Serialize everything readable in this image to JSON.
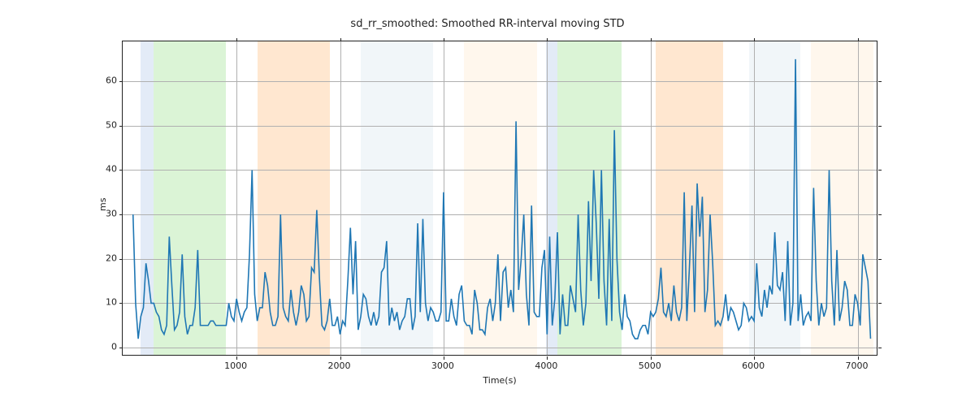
{
  "chart_data": {
    "type": "line",
    "title": "sd_rr_smoothed: Smoothed RR-interval moving STD",
    "xlabel": "Time(s)",
    "ylabel": "ms",
    "xlim": [
      -100,
      7200
    ],
    "ylim": [
      -2,
      69
    ],
    "xticks": [
      1000,
      2000,
      3000,
      4000,
      5000,
      6000,
      7000
    ],
    "yticks": [
      0,
      10,
      20,
      30,
      40,
      50,
      60
    ],
    "line_color": "#1f77b4",
    "bands": [
      {
        "x0": 70,
        "x1": 200,
        "color": "#aec7e8"
      },
      {
        "x0": 200,
        "x1": 900,
        "color": "#98df8a"
      },
      {
        "x0": 1200,
        "x1": 1900,
        "color": "#ffbb78"
      },
      {
        "x0": 2200,
        "x1": 2900,
        "color": "#d6e4ef"
      },
      {
        "x0": 3200,
        "x1": 3900,
        "color": "#ffe7cc"
      },
      {
        "x0": 3990,
        "x1": 4100,
        "color": "#aec7e8"
      },
      {
        "x0": 4100,
        "x1": 4720,
        "color": "#98df8a"
      },
      {
        "x0": 5050,
        "x1": 5700,
        "color": "#ffbb78"
      },
      {
        "x0": 5950,
        "x1": 6450,
        "color": "#d6e4ef"
      },
      {
        "x0": 6550,
        "x1": 7150,
        "color": "#ffe7cc"
      }
    ],
    "x": [
      0,
      25,
      50,
      75,
      100,
      125,
      150,
      175,
      200,
      225,
      250,
      275,
      300,
      325,
      350,
      375,
      400,
      425,
      450,
      475,
      500,
      525,
      550,
      575,
      600,
      625,
      650,
      675,
      700,
      725,
      750,
      775,
      800,
      825,
      850,
      875,
      900,
      925,
      950,
      975,
      1000,
      1025,
      1050,
      1075,
      1100,
      1125,
      1150,
      1175,
      1200,
      1225,
      1250,
      1275,
      1300,
      1325,
      1350,
      1375,
      1400,
      1425,
      1450,
      1475,
      1500,
      1525,
      1550,
      1575,
      1600,
      1625,
      1650,
      1675,
      1700,
      1725,
      1750,
      1775,
      1800,
      1825,
      1850,
      1875,
      1900,
      1925,
      1950,
      1975,
      2000,
      2025,
      2050,
      2075,
      2100,
      2125,
      2150,
      2175,
      2200,
      2225,
      2250,
      2275,
      2300,
      2325,
      2350,
      2375,
      2400,
      2425,
      2450,
      2475,
      2500,
      2525,
      2550,
      2575,
      2600,
      2625,
      2650,
      2675,
      2700,
      2725,
      2750,
      2775,
      2800,
      2825,
      2850,
      2875,
      2900,
      2925,
      2950,
      2975,
      3000,
      3025,
      3050,
      3075,
      3100,
      3125,
      3150,
      3175,
      3200,
      3225,
      3250,
      3275,
      3300,
      3325,
      3350,
      3375,
      3400,
      3425,
      3450,
      3475,
      3500,
      3525,
      3550,
      3575,
      3600,
      3625,
      3650,
      3675,
      3700,
      3725,
      3750,
      3775,
      3800,
      3825,
      3850,
      3875,
      3900,
      3925,
      3950,
      3975,
      4000,
      4025,
      4050,
      4075,
      4100,
      4125,
      4150,
      4175,
      4200,
      4225,
      4250,
      4275,
      4300,
      4325,
      4350,
      4375,
      4400,
      4425,
      4450,
      4475,
      4500,
      4525,
      4550,
      4575,
      4600,
      4625,
      4650,
      4675,
      4700,
      4725,
      4750,
      4775,
      4800,
      4825,
      4850,
      4875,
      4900,
      4925,
      4950,
      4975,
      5000,
      5025,
      5050,
      5075,
      5100,
      5125,
      5150,
      5175,
      5200,
      5225,
      5250,
      5275,
      5300,
      5325,
      5350,
      5375,
      5400,
      5425,
      5450,
      5475,
      5500,
      5525,
      5550,
      5575,
      5600,
      5625,
      5650,
      5675,
      5700,
      5725,
      5750,
      5775,
      5800,
      5825,
      5850,
      5875,
      5900,
      5925,
      5950,
      5975,
      6000,
      6025,
      6050,
      6075,
      6100,
      6125,
      6150,
      6175,
      6200,
      6225,
      6250,
      6275,
      6300,
      6325,
      6350,
      6375,
      6400,
      6425,
      6450,
      6475,
      6500,
      6525,
      6550,
      6575,
      6600,
      6625,
      6650,
      6675,
      6700,
      6725,
      6750,
      6775,
      6800,
      6825,
      6850,
      6875,
      6900,
      6925,
      6950,
      6975,
      7000,
      7025,
      7050,
      7075,
      7100,
      7125,
      7150
    ],
    "y": [
      30,
      10,
      2,
      7,
      9,
      19,
      15,
      10,
      10,
      8,
      7,
      4,
      3,
      5,
      25,
      14,
      4,
      5,
      8,
      21,
      7,
      3,
      5,
      5,
      9,
      22,
      5,
      5,
      5,
      5,
      6,
      6,
      5,
      5,
      5,
      5,
      5,
      10,
      7,
      6,
      11,
      8,
      6,
      8,
      9,
      21,
      40,
      12,
      6,
      9,
      9,
      17,
      14,
      8,
      5,
      5,
      7,
      30,
      9,
      7,
      6,
      13,
      8,
      5,
      8,
      14,
      12,
      6,
      7,
      18,
      17,
      31,
      16,
      5,
      4,
      6,
      11,
      5,
      5,
      7,
      3,
      6,
      5,
      15,
      27,
      12,
      24,
      4,
      7,
      12,
      11,
      7,
      5,
      8,
      5,
      7,
      17,
      18,
      24,
      5,
      9,
      6,
      8,
      4,
      6,
      7,
      11,
      11,
      4,
      7,
      28,
      8,
      29,
      10,
      6,
      9,
      8,
      6,
      6,
      8,
      35,
      6,
      6,
      11,
      7,
      5,
      12,
      14,
      6,
      5,
      5,
      3,
      13,
      10,
      4,
      4,
      3,
      9,
      11,
      6,
      10,
      21,
      6,
      17,
      18,
      9,
      13,
      8,
      51,
      13,
      20,
      30,
      12,
      5,
      32,
      8,
      7,
      7,
      18,
      22,
      3,
      25,
      5,
      11,
      26,
      3,
      12,
      5,
      5,
      14,
      11,
      8,
      30,
      13,
      5,
      10,
      33,
      15,
      40,
      28,
      11,
      40,
      15,
      5,
      29,
      6,
      49,
      20,
      8,
      4,
      12,
      7,
      6,
      3,
      2,
      2,
      4,
      5,
      5,
      3,
      8,
      7,
      8,
      11,
      18,
      8,
      7,
      10,
      6,
      14,
      8,
      6,
      9,
      35,
      6,
      18,
      32,
      8,
      37,
      25,
      34,
      8,
      13,
      30,
      19,
      5,
      6,
      5,
      7,
      12,
      6,
      9,
      8,
      6,
      4,
      5,
      10,
      9,
      6,
      7,
      6,
      19,
      9,
      7,
      13,
      9,
      14,
      12,
      26,
      14,
      13,
      17,
      6,
      24,
      5,
      10,
      65,
      6,
      12,
      5,
      7,
      8,
      6,
      36,
      15,
      5,
      10,
      7,
      9,
      40,
      15,
      5,
      22,
      6,
      9,
      15,
      13,
      5,
      5,
      12,
      10,
      5,
      21,
      18,
      15,
      2
    ]
  }
}
